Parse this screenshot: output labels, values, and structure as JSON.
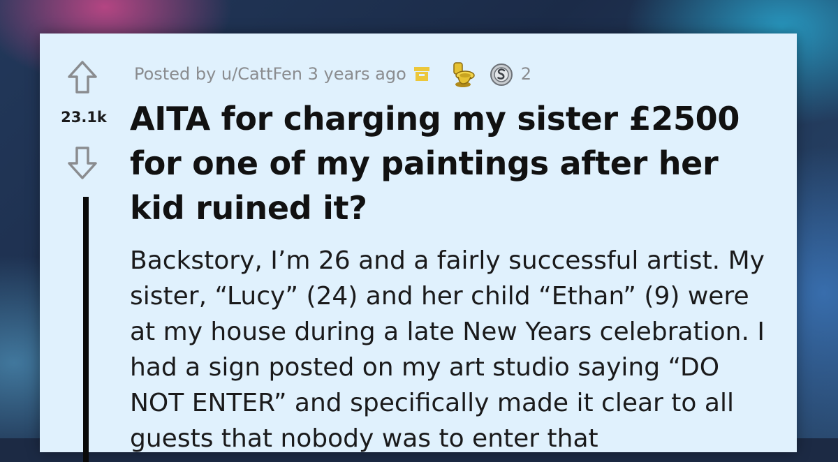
{
  "post": {
    "meta": {
      "posted_by": "Posted by u/CattFen 3 years ago",
      "award_count": "2"
    },
    "score": "23.1k",
    "title": "AITA for charging my sister £2500 for one of my paintings after her kid ruined it?",
    "body": "Backstory, I’m 26 and a fairly successful artist. My sister, “Lucy” (24) and her child “Ethan” (9) were at my house during a late New Years celebration. I had a sign posted on my art studio saying “DO NOT ENTER” and specifically made it clear to all guests that nobody was to enter that"
  },
  "icons": {
    "upvote": "arrow-up-outline-icon",
    "downvote": "arrow-down-outline-icon",
    "archived": "archive-box-icon",
    "award_1": "golden-toilet-award-icon",
    "award_2": "silver-award-icon"
  },
  "colors": {
    "card_background": "#e0f1fd",
    "meta_text": "#8a8c8f",
    "archive_icon": "#ecc73a",
    "thread_line": "#0a0a0a"
  }
}
